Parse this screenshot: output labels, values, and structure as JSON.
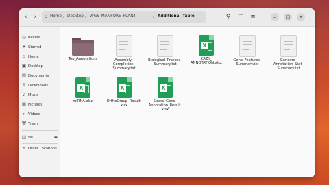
{
  "path": {
    "crumbs": [
      "Home",
      "Desktop",
      "WGS_MANFORE_PLANT",
      "Additional_Table"
    ]
  },
  "sidebar": {
    "items": [
      {
        "label": "Recent",
        "icon": "clock-icon"
      },
      {
        "label": "Starred",
        "icon": "star-icon"
      },
      {
        "label": "Home",
        "icon": "home-icon"
      },
      {
        "label": "Desktop",
        "icon": "desktop-icon"
      },
      {
        "label": "Documents",
        "icon": "document-icon"
      },
      {
        "label": "Downloads",
        "icon": "download-icon"
      },
      {
        "label": "Music",
        "icon": "music-icon"
      },
      {
        "label": "Pictures",
        "icon": "picture-icon"
      },
      {
        "label": "Videos",
        "icon": "video-icon"
      },
      {
        "label": "Trash",
        "icon": "trash-icon"
      }
    ],
    "drive": {
      "label": "WD",
      "icon": "drive-icon"
    },
    "other": {
      "label": "Other Locations",
      "icon": "plus-icon"
    }
  },
  "files": [
    {
      "name": "Top_Annotations",
      "type": "folder"
    },
    {
      "name": "Assembly_ Completion_ Summary.txt",
      "type": "text"
    },
    {
      "name": "Biological_Process_ Summary.txt",
      "type": "text"
    },
    {
      "name": "CAZY_ ANNOTATION.xlsx",
      "type": "spreadsheet"
    },
    {
      "name": "Gene_Features_ Summary.txt",
      "type": "text"
    },
    {
      "name": "Genome_ Annotation_Stat_ Summary.txt",
      "type": "text"
    },
    {
      "name": "miRNA.xlsx",
      "type": "spreadsheet"
    },
    {
      "name": "OrthoGroup_Result. xlsx",
      "type": "spreadsheet"
    },
    {
      "name": "Stress_Gene_ Annotation_Result. xlsx",
      "type": "spreadsheet"
    }
  ],
  "colors": {
    "spreadsheet": "#1f9e55",
    "folder": "#7a5a64"
  }
}
